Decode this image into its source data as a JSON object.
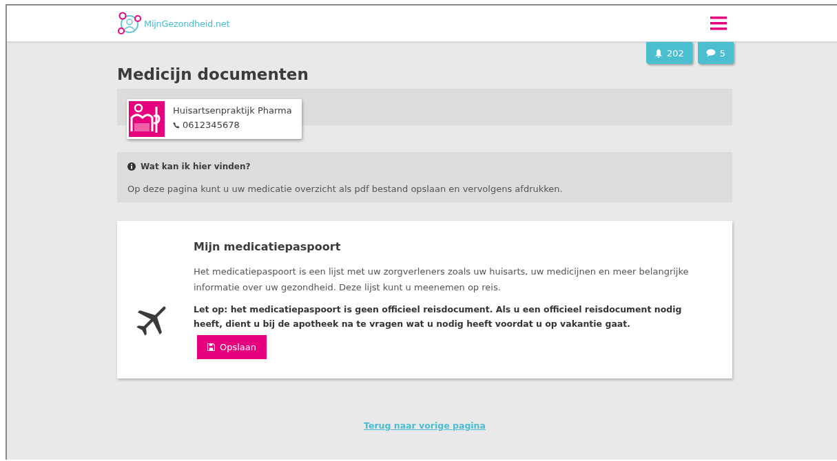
{
  "header": {
    "logo_text": "MijnGezondheid.net"
  },
  "badges": [
    {
      "kind": "bell",
      "count": "202"
    },
    {
      "kind": "chat",
      "count": "5"
    }
  ],
  "title": "Medicijn documenten",
  "pharmacy": {
    "name": "Huisartsenpraktijk Pharma",
    "phone": "0612345678"
  },
  "info": {
    "heading": "Wat kan ik hier vinden?",
    "text": "Op deze pagina kunt u uw medicatie overzicht als pdf bestand opslaan en vervolgens afdrukken."
  },
  "passport": {
    "heading": "Mijn medicatiepaspoort",
    "text": "Het medicatiepaspoort is een lijst met uw zorgverleners zoals uw huisarts, uw medicijnen en meer belangrijke informatie over uw gezondheid. Deze lijst kunt u meenemen op reis.",
    "warning": "Let op: het medicatiepaspoort is geen officieel reisdocument. Als u een officieel reisdocument nodig heeft, dient u bij de apotheek na te vragen wat u nodig heeft voordat u op vakantie gaat.",
    "button": "Opslaan"
  },
  "back_link": "Terug naar vorige pagina"
}
